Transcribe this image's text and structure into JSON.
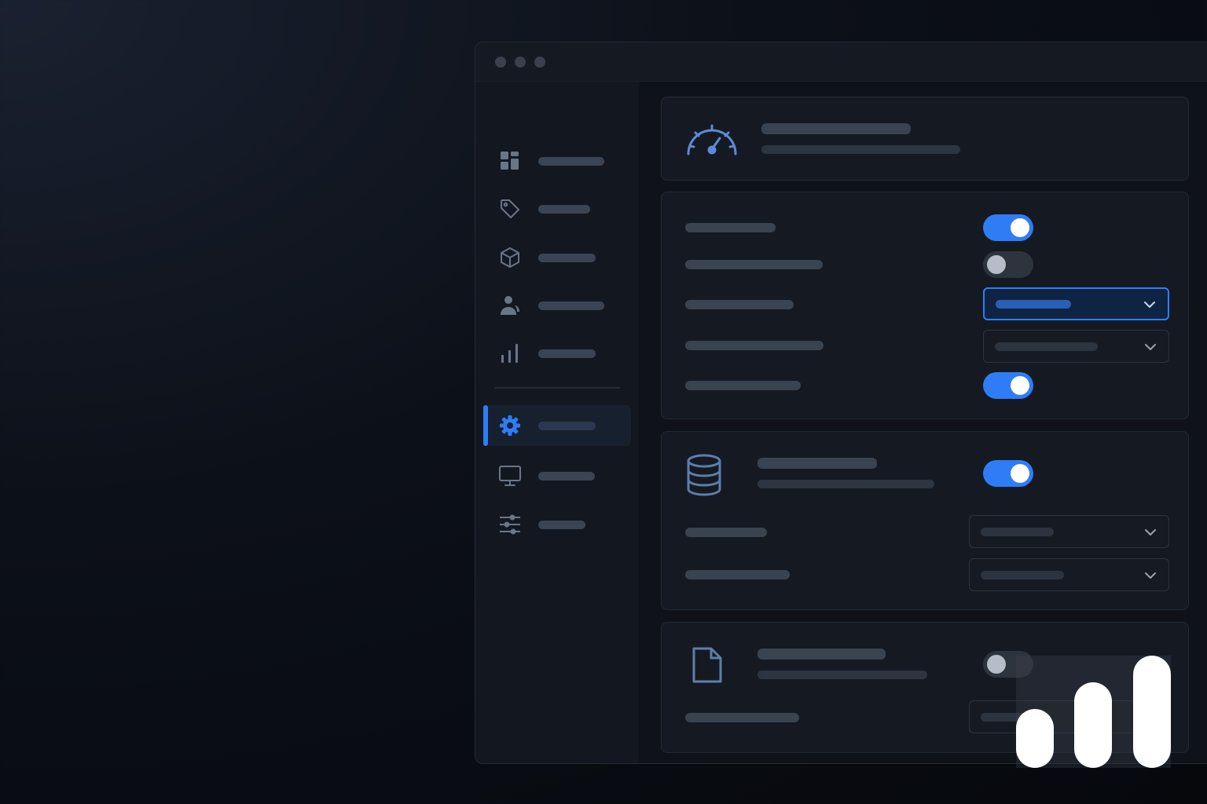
{
  "window": {
    "controls": [
      "close",
      "minimize",
      "maximize"
    ]
  },
  "sidebar": {
    "items": [
      {
        "icon": "grid-icon",
        "active": false
      },
      {
        "icon": "tag-icon",
        "active": false
      },
      {
        "icon": "cube-icon",
        "active": false
      },
      {
        "icon": "users-icon",
        "active": false
      },
      {
        "icon": "bar-chart-icon",
        "active": false
      },
      {
        "icon": "gear-icon",
        "active": true
      },
      {
        "icon": "monitor-icon",
        "active": false
      },
      {
        "icon": "sliders-icon",
        "active": false
      }
    ]
  },
  "header_card": {
    "icon": "gauge-icon"
  },
  "settings_card": {
    "rows": [
      {
        "control": "toggle",
        "on": true
      },
      {
        "control": "toggle",
        "on": false
      },
      {
        "control": "select",
        "focused": true
      },
      {
        "control": "select",
        "focused": false
      },
      {
        "control": "toggle",
        "on": true
      }
    ]
  },
  "database_card": {
    "icon": "database-icon",
    "toggle_on": true,
    "rows": [
      {
        "control": "select"
      },
      {
        "control": "select"
      }
    ]
  },
  "file_card": {
    "icon": "file-icon",
    "toggle_on": false,
    "rows": [
      {
        "control": "select"
      }
    ]
  },
  "colors": {
    "accent": "#2f7df6",
    "background": "#0c1018",
    "card": "#151a22"
  },
  "logo": {
    "icon": "bar-logo-icon"
  }
}
